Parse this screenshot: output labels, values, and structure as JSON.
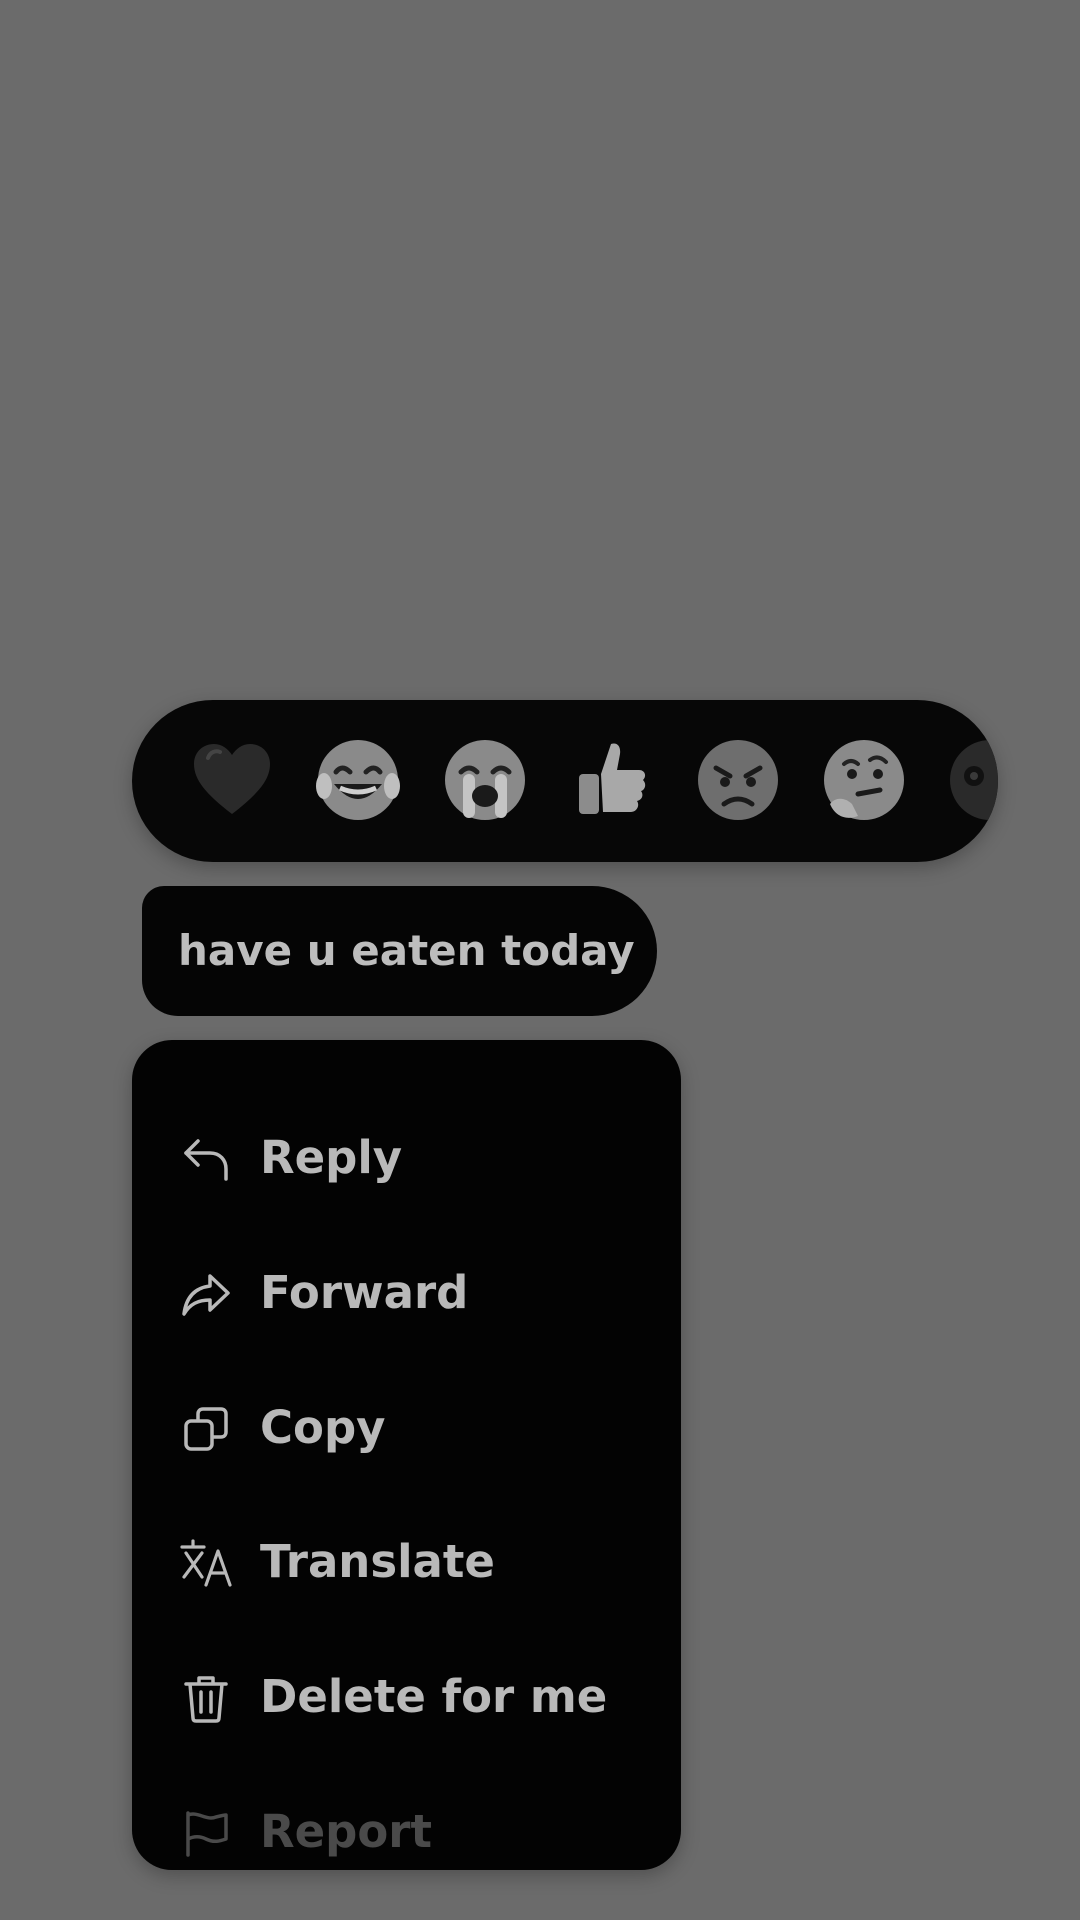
{
  "reactions": [
    {
      "name": "heart",
      "glyph": "❤️"
    },
    {
      "name": "laughing-crying",
      "glyph": "😂"
    },
    {
      "name": "loudly-crying",
      "glyph": "😭"
    },
    {
      "name": "thumbs-up",
      "glyph": "👍"
    },
    {
      "name": "angry",
      "glyph": "😠"
    },
    {
      "name": "thinking",
      "glyph": "🤔"
    },
    {
      "name": "more",
      "glyph": "😳"
    }
  ],
  "message": {
    "text": "have u eaten today"
  },
  "menu": {
    "items": [
      {
        "label": "Reply",
        "icon": "reply-icon",
        "enabled": true
      },
      {
        "label": "Forward",
        "icon": "forward-icon",
        "enabled": true
      },
      {
        "label": "Copy",
        "icon": "copy-icon",
        "enabled": true
      },
      {
        "label": "Translate",
        "icon": "translate-icon",
        "enabled": true
      },
      {
        "label": "Delete for me",
        "icon": "trash-icon",
        "enabled": true
      },
      {
        "label": "Report",
        "icon": "flag-icon",
        "enabled": false
      }
    ]
  },
  "colors": {
    "overlay": "#6b6b6b",
    "surface": "#050505",
    "text": "#bdbdbd",
    "disabled_text": "#4a4a4a"
  }
}
